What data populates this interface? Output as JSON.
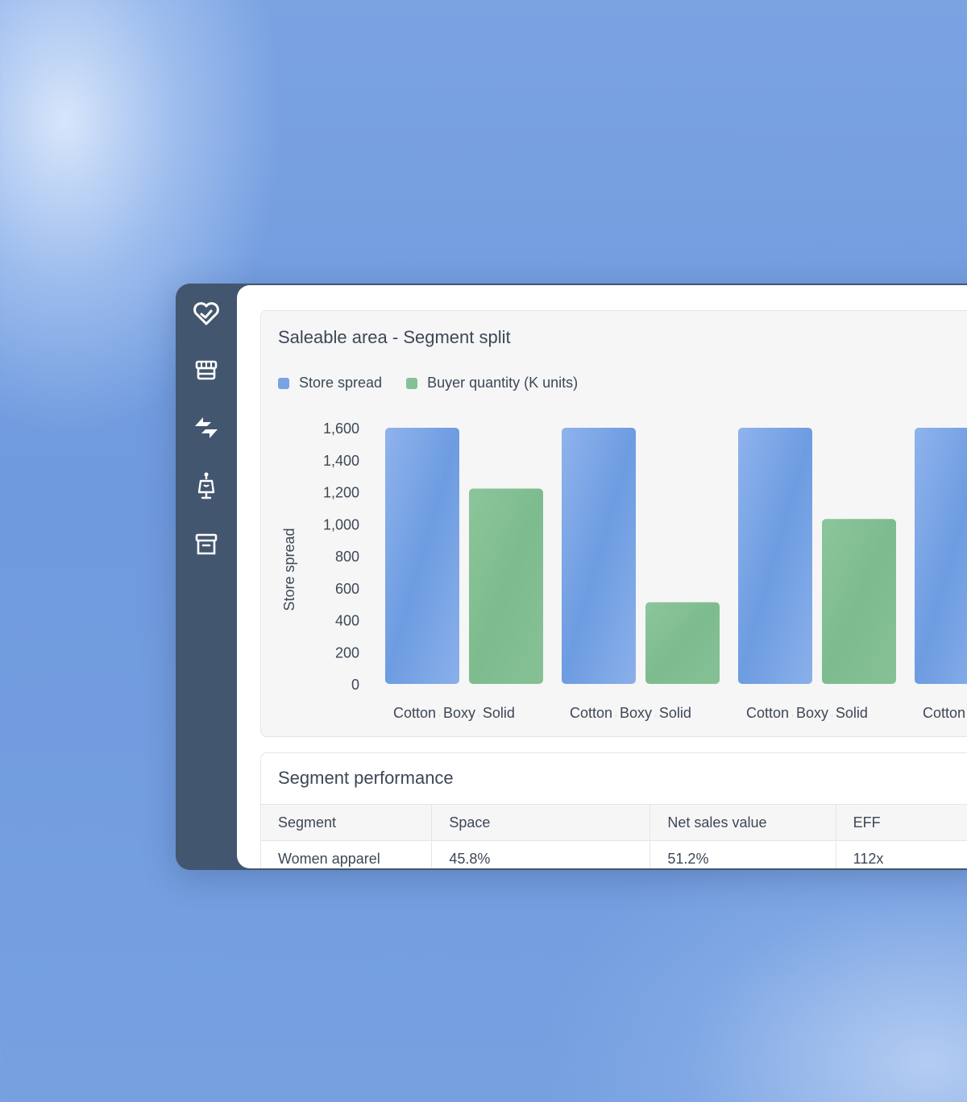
{
  "sidebar": {
    "items": [
      {
        "icon": "heart-check-icon"
      },
      {
        "icon": "store-icon"
      },
      {
        "icon": "exchange-icon"
      },
      {
        "icon": "mannequin-icon"
      },
      {
        "icon": "archive-icon"
      }
    ]
  },
  "chart_card": {
    "title": "Saleable area - Segment split"
  },
  "chart_data": {
    "type": "bar",
    "title": "Saleable area - Segment split",
    "ylabel": "Store spread",
    "xlabel": "",
    "ylim": [
      0,
      1600
    ],
    "yticks": [
      "1,600",
      "1,400",
      "1,200",
      "1,000",
      "800",
      "600",
      "400",
      "200",
      "0"
    ],
    "legend": "top-left",
    "grid": false,
    "groups": [
      {
        "label_parts": [
          "Cotton",
          "Boxy",
          "Solid"
        ],
        "values": [
          1600,
          1220
        ]
      },
      {
        "label_parts": [
          "Cotton",
          "Boxy",
          "Solid"
        ],
        "values": [
          1600,
          510
        ]
      },
      {
        "label_parts": [
          "Cotton",
          "Boxy",
          "Solid"
        ],
        "values": [
          1600,
          1030
        ]
      },
      {
        "label_parts": [
          "Cotton"
        ],
        "values": [
          1600
        ]
      }
    ],
    "series": [
      {
        "name": "Store spread",
        "color": "#7aa3e6"
      },
      {
        "name": "Buyer quantity (K units)",
        "color": "#86c196"
      }
    ]
  },
  "table_card": {
    "title": "Segment performance",
    "columns": [
      "Segment",
      "Space",
      "Net sales value",
      "EFF"
    ],
    "rows": [
      [
        "Women apparel",
        "45.8%",
        "51.2%",
        "112x"
      ]
    ]
  }
}
